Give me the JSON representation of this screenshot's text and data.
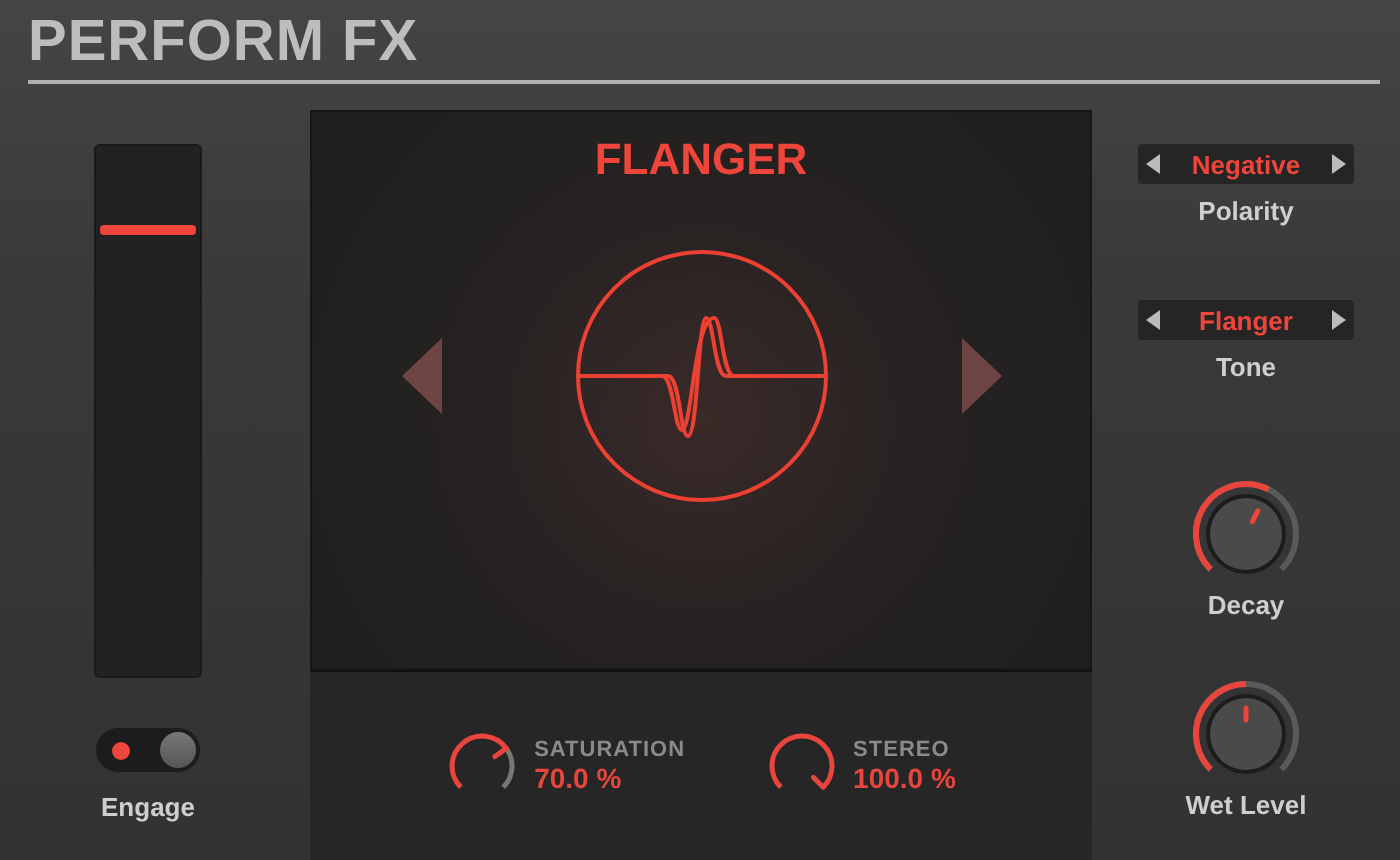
{
  "title": "PERFORM FX",
  "fader": {
    "level": 0.84
  },
  "engage": {
    "label": "Engage",
    "on": true
  },
  "effect": {
    "name": "FLANGER"
  },
  "parameters": [
    {
      "label": "SATURATION",
      "value": "70.0 %"
    },
    {
      "label": "STEREO",
      "value": "100.0 %"
    }
  ],
  "selectors": [
    {
      "value": "Negative",
      "label": "Polarity"
    },
    {
      "value": "Flanger",
      "label": "Tone"
    }
  ],
  "knobs": [
    {
      "label": "Decay"
    },
    {
      "label": "Wet Level"
    }
  ]
}
